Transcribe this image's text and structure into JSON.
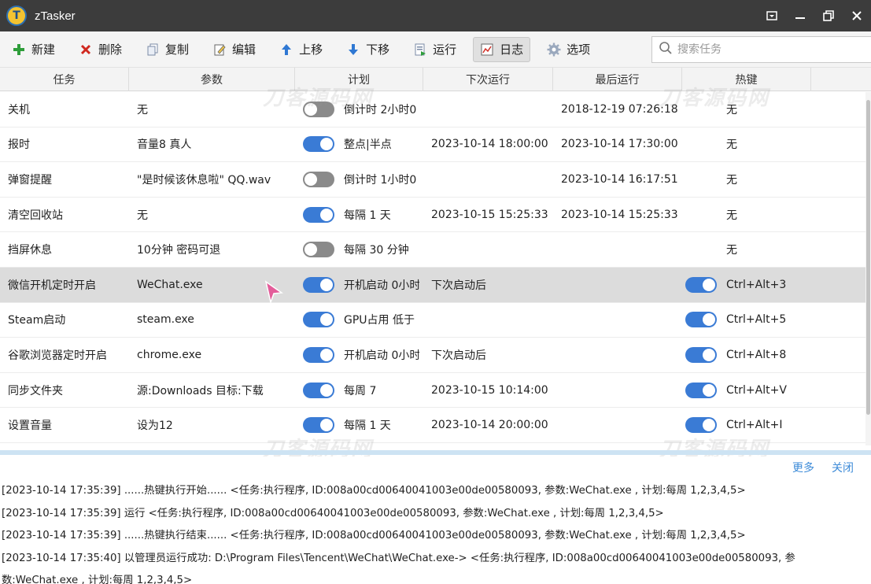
{
  "window": {
    "title": "zTasker",
    "logo_letter": "T"
  },
  "toolbar": {
    "items": [
      {
        "label": "新建",
        "icon": "plus-icon",
        "color": "#2e9d3a"
      },
      {
        "label": "删除",
        "icon": "delete-x-icon",
        "color": "#d0281f"
      },
      {
        "label": "复制",
        "icon": "copy-icon",
        "color": "#5a6f8f"
      },
      {
        "label": "编辑",
        "icon": "edit-icon",
        "color": "#555555"
      },
      {
        "label": "上移",
        "icon": "arrow-up-icon",
        "color": "#2f78d3"
      },
      {
        "label": "下移",
        "icon": "arrow-down-icon",
        "color": "#2f78d3"
      },
      {
        "label": "运行",
        "icon": "run-icon",
        "color": "#5a6f8f"
      },
      {
        "label": "日志",
        "icon": "log-chart-icon",
        "color": "#555555",
        "active": true
      },
      {
        "label": "选项",
        "icon": "gear-icon",
        "color": "#5a6f8f"
      }
    ],
    "search_placeholder": "搜索任务"
  },
  "table": {
    "headers": [
      "任务",
      "参数",
      "计划",
      "下次运行",
      "最后运行",
      "热键"
    ],
    "rows": [
      {
        "task": "关机",
        "param": "无",
        "enabled": false,
        "plan": "倒计时 2小时0",
        "next": "",
        "last": "2018-12-19 07:26:18",
        "hot_toggle": null,
        "hotkey": "无"
      },
      {
        "task": "报时",
        "param": "音量8 真人",
        "enabled": true,
        "plan": "整点|半点",
        "next": "2023-10-14 18:00:00",
        "last": "2023-10-14 17:30:00",
        "hot_toggle": null,
        "hotkey": "无"
      },
      {
        "task": "弹窗提醒",
        "param": "\"是时候该休息啦\" QQ.wav",
        "enabled": false,
        "plan": "倒计时 1小时0",
        "next": "",
        "last": "2023-10-14 16:17:51",
        "hot_toggle": null,
        "hotkey": "无"
      },
      {
        "task": "清空回收站",
        "param": "无",
        "enabled": true,
        "plan": "每隔 1 天",
        "next": "2023-10-15 15:25:33",
        "last": "2023-10-14 15:25:33",
        "hot_toggle": null,
        "hotkey": "无"
      },
      {
        "task": "挡屏休息",
        "param": "10分钟 密码可退",
        "enabled": false,
        "plan": "每隔 30 分钟",
        "next": "",
        "last": "",
        "hot_toggle": null,
        "hotkey": "无"
      },
      {
        "task": "微信开机定时开启",
        "param": "WeChat.exe",
        "enabled": true,
        "plan": "开机启动 0小时",
        "next": "下次启动后",
        "last": "",
        "hot_toggle": true,
        "hotkey": "Ctrl+Alt+3",
        "selected": true
      },
      {
        "task": "Steam启动",
        "param": "steam.exe",
        "enabled": true,
        "plan": "GPU占用 低于",
        "next": "",
        "last": "",
        "hot_toggle": true,
        "hotkey": "Ctrl+Alt+5"
      },
      {
        "task": "谷歌浏览器定时开启",
        "param": "chrome.exe",
        "enabled": true,
        "plan": "开机启动 0小时",
        "next": "下次启动后",
        "last": "",
        "hot_toggle": true,
        "hotkey": "Ctrl+Alt+8"
      },
      {
        "task": "同步文件夹",
        "param": "源:Downloads 目标:下载",
        "enabled": true,
        "plan": "每周 7",
        "next": "2023-10-15 10:14:00",
        "last": "",
        "hot_toggle": true,
        "hotkey": "Ctrl+Alt+V"
      },
      {
        "task": "设置音量",
        "param": "设为12",
        "enabled": true,
        "plan": "每隔 1 天",
        "next": "2023-10-14 20:00:00",
        "last": "",
        "hot_toggle": true,
        "hotkey": "Ctrl+Alt+I"
      }
    ]
  },
  "log": {
    "more_label": "更多",
    "close_label": "关闭",
    "lines": [
      "[2023-10-14 17:35:39] ......热键执行开始...... <任务:执行程序, ID:008a00cd00640041003e00de00580093, 参数:WeChat.exe , 计划:每周 1,2,3,4,5>",
      "[2023-10-14 17:35:39] 运行 <任务:执行程序, ID:008a00cd00640041003e00de00580093, 参数:WeChat.exe , 计划:每周 1,2,3,4,5>",
      "[2023-10-14 17:35:39] ......热键执行结束...... <任务:执行程序, ID:008a00cd00640041003e00de00580093, 参数:WeChat.exe , 计划:每周 1,2,3,4,5>",
      "[2023-10-14 17:35:40] 以管理员运行成功: D:\\Program Files\\Tencent\\WeChat\\WeChat.exe-> <任务:执行程序, ID:008a00cd00640041003e00de00580093, 参",
      "数:WeChat.exe , 计划:每周 1,2,3,4,5>"
    ]
  },
  "watermark": "刀客源码网",
  "colors": {
    "accent": "#3a7bd5",
    "titlebar": "#3c3c3c",
    "link": "#3d8bd8"
  }
}
